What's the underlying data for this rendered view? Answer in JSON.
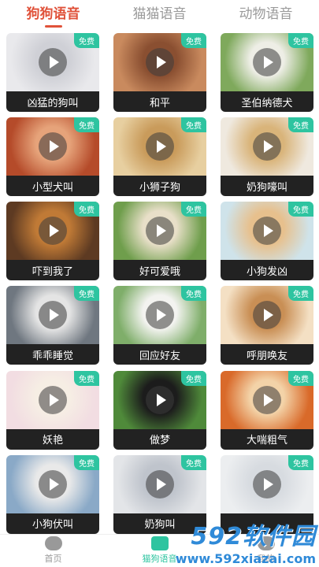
{
  "tabs": [
    {
      "label": "狗狗语音",
      "active": true
    },
    {
      "label": "猫猫语音",
      "active": false
    },
    {
      "label": "动物语音",
      "active": false
    }
  ],
  "badge_text": "免费",
  "cards": [
    {
      "title": "凶猛的狗叫",
      "colors": [
        "#e9e9ec",
        "#cfd0d6"
      ]
    },
    {
      "title": "和平",
      "colors": [
        "#c98a5e",
        "#8a4f31"
      ]
    },
    {
      "title": "圣伯纳德犬",
      "colors": [
        "#7fa95c",
        "#eeeee6"
      ]
    },
    {
      "title": "小型犬叫",
      "colors": [
        "#b54b2a",
        "#e6a37a"
      ]
    },
    {
      "title": "小狮子狗",
      "colors": [
        "#e7cfa0",
        "#c99b5b"
      ]
    },
    {
      "title": "奶狗嚎叫",
      "colors": [
        "#efe9df",
        "#d9b47a"
      ]
    },
    {
      "title": "吓到我了",
      "colors": [
        "#5d3a22",
        "#c07a36"
      ]
    },
    {
      "title": "好可爱哦",
      "colors": [
        "#6f9e4c",
        "#e8dfc8"
      ]
    },
    {
      "title": "小狗发凶",
      "colors": [
        "#cfe3ea",
        "#e7c08d"
      ]
    },
    {
      "title": "乖乖睡觉",
      "colors": [
        "#6f7780",
        "#e4e4e4"
      ]
    },
    {
      "title": "回应好友",
      "colors": [
        "#7fae6a",
        "#f3f3f0"
      ]
    },
    {
      "title": "呼朋唤友",
      "colors": [
        "#f4e0c4",
        "#c98f55"
      ]
    },
    {
      "title": "妖艳",
      "colors": [
        "#f2dde2",
        "#f6eee4"
      ]
    },
    {
      "title": "做梦",
      "colors": [
        "#4f8a3a",
        "#1c1c1c"
      ]
    },
    {
      "title": "大喘粗气",
      "colors": [
        "#d96a2a",
        "#f3d3a8"
      ]
    },
    {
      "title": "小狗伏叫",
      "colors": [
        "#8aa9c7",
        "#e9e9e9"
      ]
    },
    {
      "title": "奶狗叫",
      "colors": [
        "#e3e5e8",
        "#bfc4cc"
      ]
    },
    {
      "title": "",
      "colors": [
        "#eceef0",
        "#d7dbe0"
      ]
    }
  ],
  "bottom_nav": [
    {
      "label": "首页",
      "icon": "chat-bubble-icon",
      "active": false
    },
    {
      "label": "猫狗语音",
      "icon": "paw-icon",
      "active": true
    },
    {
      "label": "我的",
      "icon": "user-icon",
      "active": false
    }
  ],
  "watermark": {
    "main": "592软件园",
    "url": "www.592xiazai.com"
  }
}
